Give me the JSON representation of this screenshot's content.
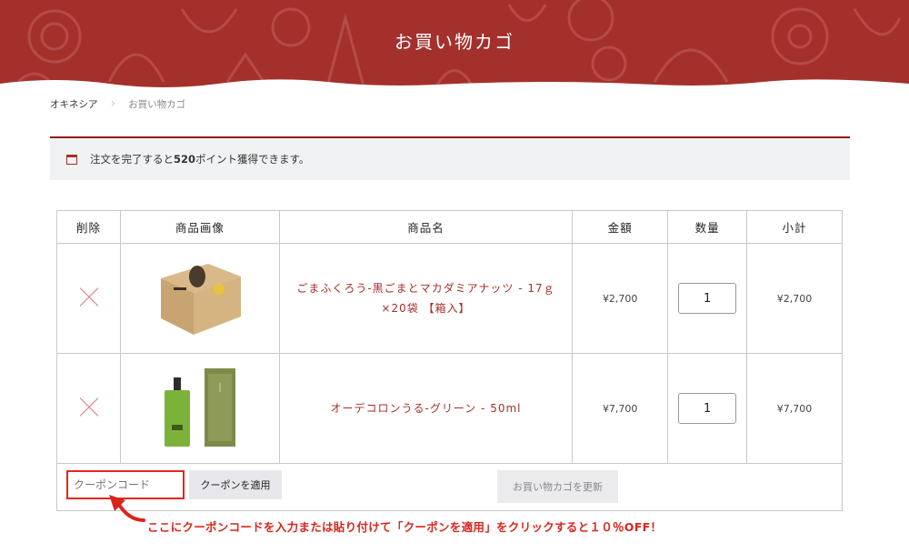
{
  "header": {
    "title": "お買い物カゴ"
  },
  "breadcrumb": {
    "home": "オキネシア",
    "separator": "›",
    "current": "お買い物カゴ"
  },
  "notice": {
    "prefix": "注文を完了すると",
    "points": "520",
    "suffix": " ポイント獲得できます。"
  },
  "table": {
    "headers": {
      "remove": "削除",
      "image": "商品画像",
      "name": "商品名",
      "price": "金額",
      "quantity": "数量",
      "subtotal": "小計"
    },
    "rows": [
      {
        "name": "ごまふくろう-黒ごまとマカダミアナッツ - 17ｇ×20袋 【箱入】",
        "price": "¥2,700",
        "quantity": "1",
        "subtotal": "¥2,700"
      },
      {
        "name": "オーデコロンうる-グリーン - 50ml",
        "price": "¥7,700",
        "quantity": "1",
        "subtotal": "¥7,700"
      }
    ]
  },
  "coupon": {
    "placeholder": "クーポンコード",
    "apply_label": "クーポンを適用"
  },
  "update_label": "お買い物カゴを更新",
  "annotation": "ここにクーポンコードを入力または貼り付けて「クーポンを適用」をクリックすると１０％OFF！",
  "colors": {
    "brand": "#a4302c",
    "annotation": "#d9261c",
    "notice_border": "#8b1e1a"
  }
}
